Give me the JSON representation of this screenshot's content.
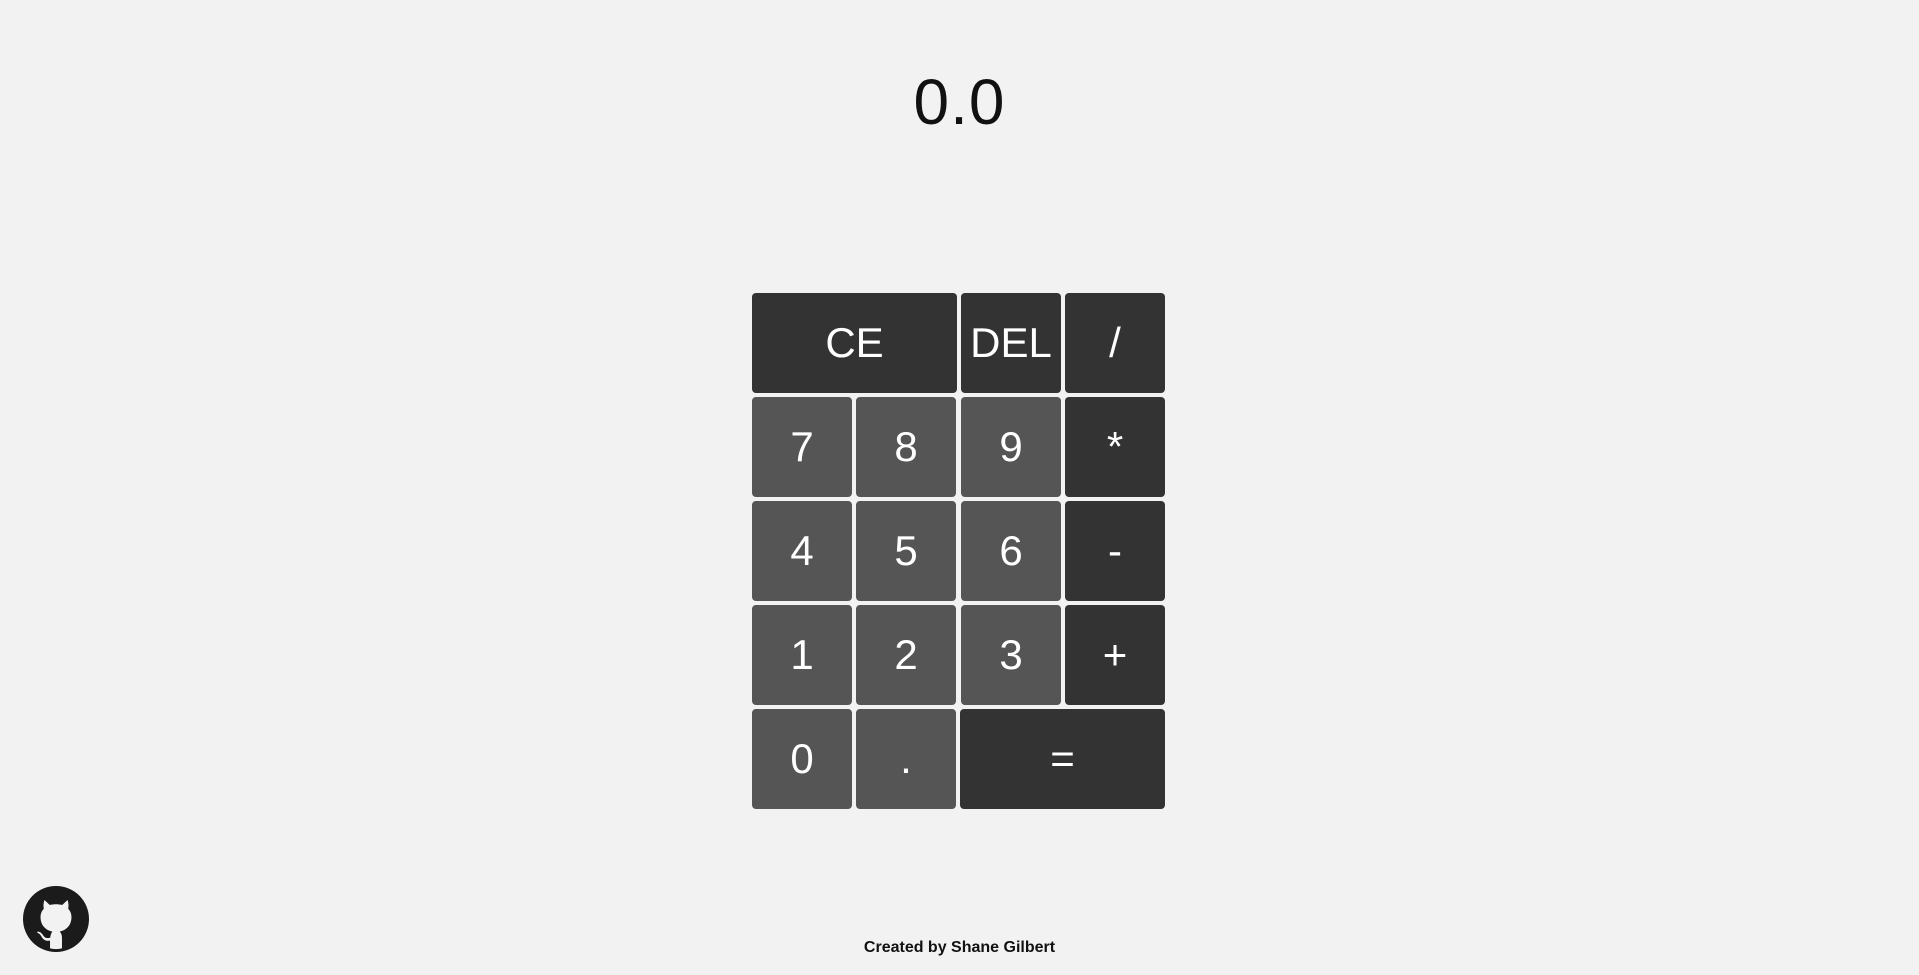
{
  "display": {
    "value": "0.0"
  },
  "keypad": {
    "ce": "CE",
    "del": "DEL",
    "divide": "/",
    "seven": "7",
    "eight": "8",
    "nine": "9",
    "multiply": "*",
    "four": "4",
    "five": "5",
    "six": "6",
    "subtract": "-",
    "one": "1",
    "two": "2",
    "three": "3",
    "add": "+",
    "zero": "0",
    "decimal": ".",
    "equals": "="
  },
  "footer": {
    "credit": "Created by Shane Gilbert"
  },
  "icons": {
    "github": "github-icon"
  },
  "colors": {
    "background": "#f2f2f2",
    "number_key": "#555555",
    "operator_key": "#333333",
    "key_text": "#ffffff",
    "display_text": "#111111"
  }
}
